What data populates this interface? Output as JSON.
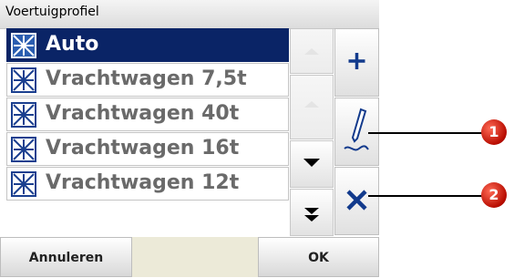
{
  "window": {
    "title": "Voertuigprofiel"
  },
  "profiles": [
    {
      "label": "Auto",
      "selected": true
    },
    {
      "label": "Vrachtwagen 7,5t",
      "selected": false
    },
    {
      "label": "Vrachtwagen 40t",
      "selected": false
    },
    {
      "label": "Vrachtwagen 16t",
      "selected": false
    },
    {
      "label": "Vrachtwagen 12t",
      "selected": false
    }
  ],
  "icons": {
    "profile": "vehicle-profile-icon",
    "add": "plus-icon",
    "edit": "pen-icon",
    "delete": "x-icon",
    "scroll_up": "chevron-up-icon",
    "page_up": "double-chevron-up-icon",
    "scroll_down": "chevron-down-icon",
    "page_down": "double-chevron-down-icon"
  },
  "buttons": {
    "cancel_label": "Annuleren",
    "ok_label": "OK"
  },
  "callouts": [
    {
      "number": "1"
    },
    {
      "number": "2"
    }
  ],
  "colors": {
    "selection": "#0a2466",
    "callout": "#c00000",
    "action_icon": "#123a8c"
  }
}
